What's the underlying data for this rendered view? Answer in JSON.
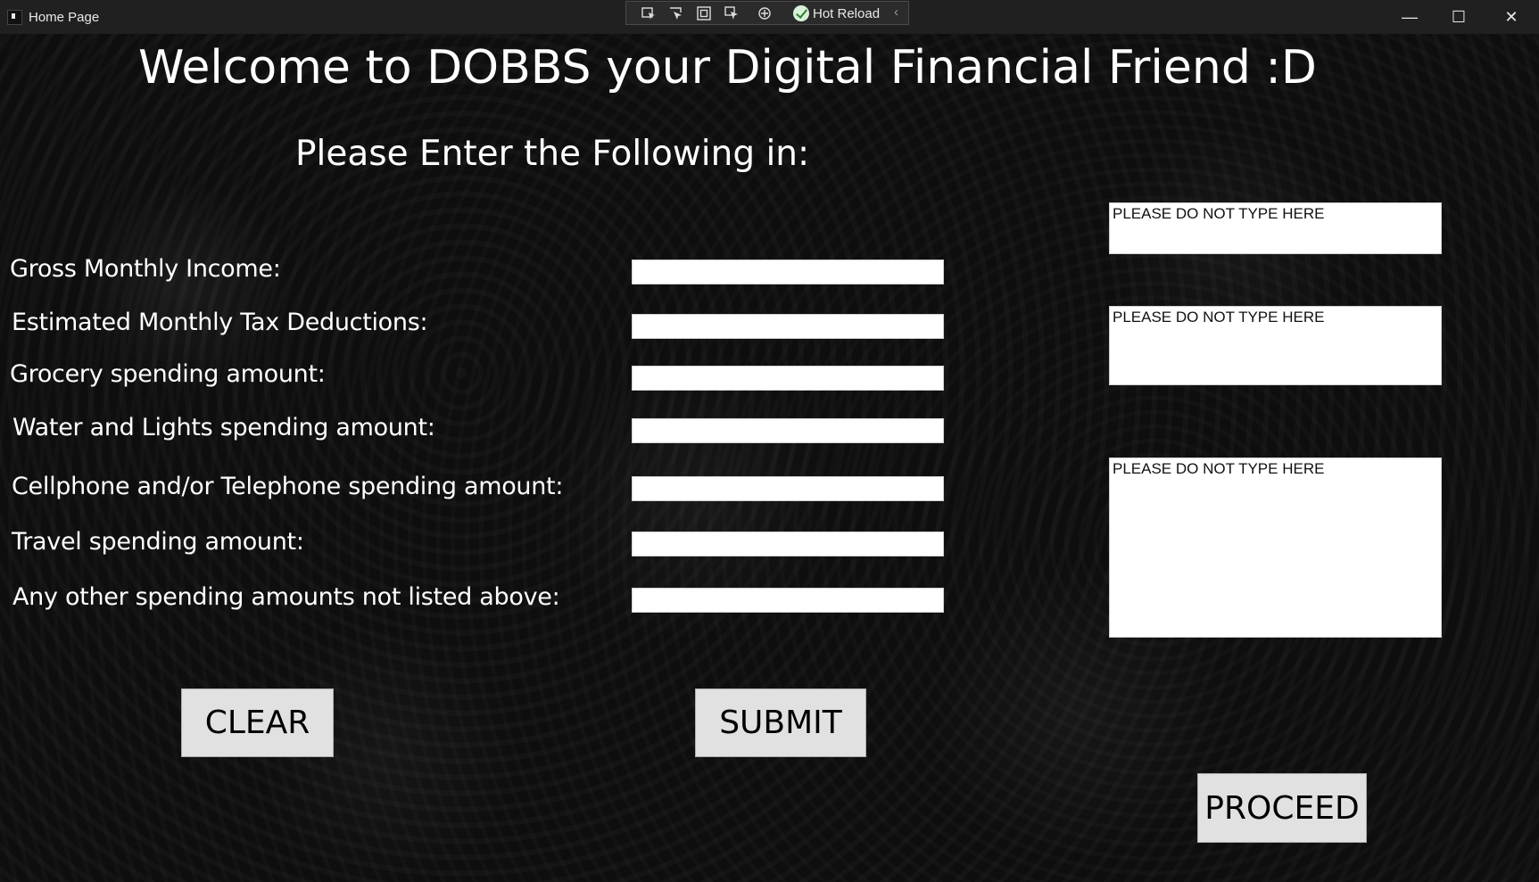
{
  "window": {
    "title": "Home Page",
    "hot_reload_label": "Hot Reload",
    "controls": {
      "minimize": "—",
      "maximize": "☐",
      "close": "✕"
    },
    "devtools": [
      "select-element-icon",
      "live-tree-icon",
      "display-layout-adorners-icon",
      "track-focused-element-icon",
      "binding-failures-icon"
    ]
  },
  "main": {
    "title": "Welcome to DOBBS your Digital Financial Friend :D",
    "subtitle": "Please Enter the Following in:",
    "fields": [
      {
        "label": "Gross Monthly Income:",
        "value": ""
      },
      {
        "label": "Estimated Monthly Tax Deductions:",
        "value": ""
      },
      {
        "label": "Grocery spending amount:",
        "value": ""
      },
      {
        "label": "Water and Lights spending amount:",
        "value": ""
      },
      {
        "label": "Cellphone and/or Telephone spending amount:",
        "value": ""
      },
      {
        "label": "Travel spending amount:",
        "value": ""
      },
      {
        "label": "Any other spending amounts not listed above:",
        "value": ""
      }
    ],
    "output_boxes": [
      {
        "text": "PLEASE DO NOT TYPE HERE"
      },
      {
        "text": "PLEASE DO NOT TYPE HERE"
      },
      {
        "text": "PLEASE DO NOT TYPE HERE"
      }
    ],
    "buttons": {
      "clear": "CLEAR",
      "submit": "SUBMIT",
      "proceed": "PROCEED"
    }
  }
}
